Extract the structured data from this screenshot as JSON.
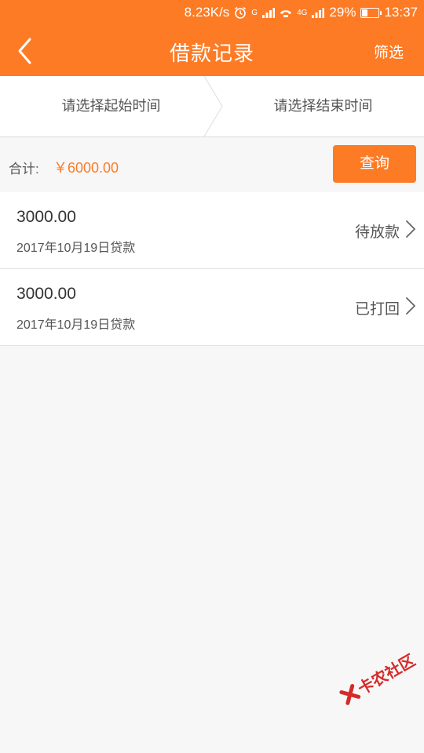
{
  "status_bar": {
    "net_speed": "8.23K/s",
    "sim1_label": "G",
    "sim2_label": "4G",
    "battery_percent": "29%",
    "time": "13:37"
  },
  "nav": {
    "title": "借款记录",
    "filter_label": "筛选"
  },
  "date_range": {
    "start_placeholder": "请选择起始时间",
    "end_placeholder": "请选择结束时间"
  },
  "summary": {
    "total_label": "合计:",
    "total_amount": "￥6000.00",
    "query_label": "查询"
  },
  "loans": [
    {
      "amount": "3000.00",
      "date": "2017年10月19日贷款",
      "status": "待放款"
    },
    {
      "amount": "3000.00",
      "date": "2017年10月19日贷款",
      "status": "已打回"
    }
  ],
  "watermark": {
    "text": "卡农社区"
  },
  "colors": {
    "accent": "#fd7b25",
    "background": "#f7f7f7",
    "watermark": "#d62a2a"
  }
}
